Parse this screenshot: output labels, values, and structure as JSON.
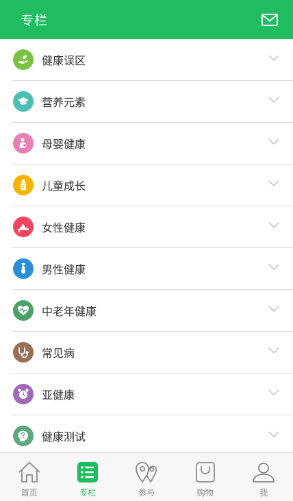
{
  "header": {
    "title": "专栏",
    "mail_icon": "mail-icon"
  },
  "colors": {
    "brand": "#1fbd5f",
    "divider": "#d9d9d9",
    "chevron": "#c6c6c6"
  },
  "categories": [
    {
      "label": "健康误区",
      "icon": "hand-leaf-icon",
      "color": "#7cc242"
    },
    {
      "label": "营养元素",
      "icon": "graduation-cap-icon",
      "color": "#4bbfb1"
    },
    {
      "label": "母婴健康",
      "icon": "mother-baby-icon",
      "color": "#e97fb7"
    },
    {
      "label": "儿童成长",
      "icon": "baby-bottle-icon",
      "color": "#f7b500"
    },
    {
      "label": "女性健康",
      "icon": "high-heel-icon",
      "color": "#f0455e"
    },
    {
      "label": "男性健康",
      "icon": "necktie-icon",
      "color": "#2a8fd6"
    },
    {
      "label": "中老年健康",
      "icon": "heart-pulse-icon",
      "color": "#4da066"
    },
    {
      "label": "常见病",
      "icon": "stethoscope-icon",
      "color": "#9b6f55"
    },
    {
      "label": "亚健康",
      "icon": "alarm-clock-icon",
      "color": "#a269b9"
    },
    {
      "label": "健康测试",
      "icon": "question-head-icon",
      "color": "#5aa97f"
    }
  ],
  "tabbar": [
    {
      "label": "首页",
      "icon": "home-icon",
      "active": false
    },
    {
      "label": "专栏",
      "icon": "list-icon",
      "active": true
    },
    {
      "label": "参与",
      "icon": "map-pins-icon",
      "active": false
    },
    {
      "label": "购物",
      "icon": "shopping-bag-icon",
      "active": false
    },
    {
      "label": "我",
      "icon": "user-icon",
      "active": false
    }
  ]
}
